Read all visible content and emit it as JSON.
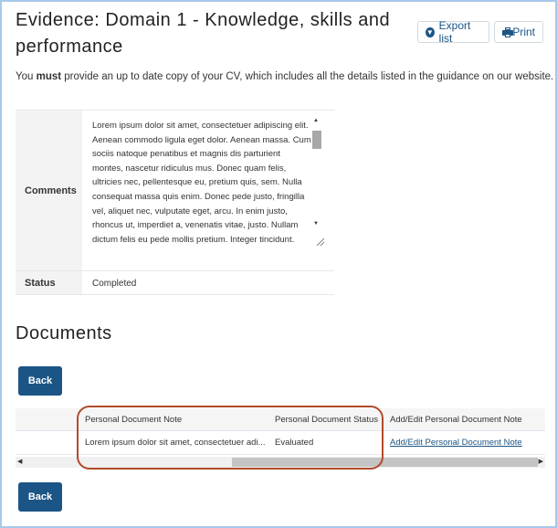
{
  "header": {
    "title": "Evidence: Domain 1 - Knowledge, skills and performance",
    "export_label": "Export list",
    "print_label": "Print"
  },
  "intro": {
    "prefix": "You ",
    "emphasis": "must",
    "suffix": " provide an up to date copy of your CV, which includes all the details listed in the guidance on our website."
  },
  "details": {
    "comments_label": "Comments",
    "comments_text": "Lorem ipsum dolor sit amet, consectetuer adipiscing elit. Aenean commodo ligula eget dolor. Aenean massa. Cum sociis natoque penatibus et magnis dis parturient montes, nascetur ridiculus mus. Donec quam felis, ultricies nec, pellentesque eu, pretium quis, sem. Nulla consequat massa quis enim. Donec pede justo, fringilla vel, aliquet nec, vulputate eget, arcu. In enim justo, rhoncus ut, imperdiet a, venenatis vitae, justo. Nullam dictum felis eu pede mollis pretium. Integer tincidunt.",
    "status_label": "Status",
    "status_value": "Completed"
  },
  "documents": {
    "heading": "Documents",
    "back_label": "Back",
    "columns": [
      "Personal Document Note",
      "Personal Document Status",
      "Add/Edit Personal Document Note"
    ],
    "rows": [
      {
        "note": "Lorem ipsum dolor sit amet, consectetuer adi...",
        "status": "Evaluated",
        "action": "Add/Edit Personal Document Note"
      }
    ]
  },
  "colors": {
    "primary": "#1b5586",
    "highlight": "#b24b2c"
  }
}
